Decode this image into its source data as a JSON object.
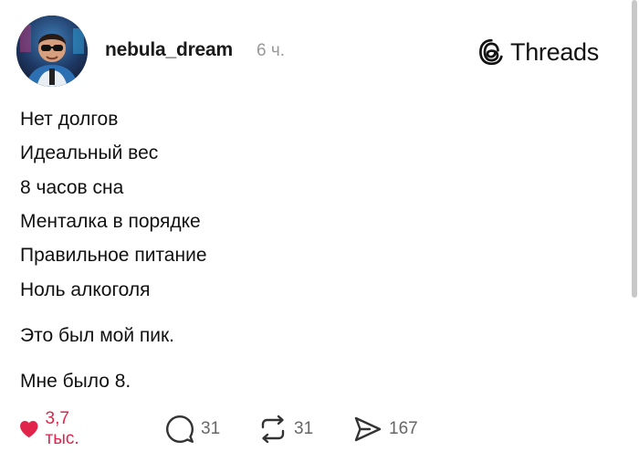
{
  "post": {
    "username": "nebula_dream",
    "time": "6 ч.",
    "lines": [
      "Нет долгов",
      "Идеальный вес",
      "8 часов сна",
      "Менталка в порядке",
      "Правильное питание",
      "Ноль алкоголя"
    ],
    "paragraph_1": "Это был мой пик.",
    "paragraph_2": "Мне было 8."
  },
  "brand": {
    "name": "Threads",
    "icon": "threads-logo-icon"
  },
  "actions": {
    "like": {
      "count": "3,7 тыс.",
      "icon": "heart-filled-icon",
      "liked": true
    },
    "comment": {
      "count": "31",
      "icon": "comment-bubble-icon"
    },
    "repost": {
      "count": "31",
      "icon": "repost-icon"
    },
    "share": {
      "count": "167",
      "icon": "send-icon"
    }
  },
  "colors": {
    "like_active": "#e0244a",
    "muted": "#666666",
    "time": "#999999",
    "text": "#111111"
  }
}
